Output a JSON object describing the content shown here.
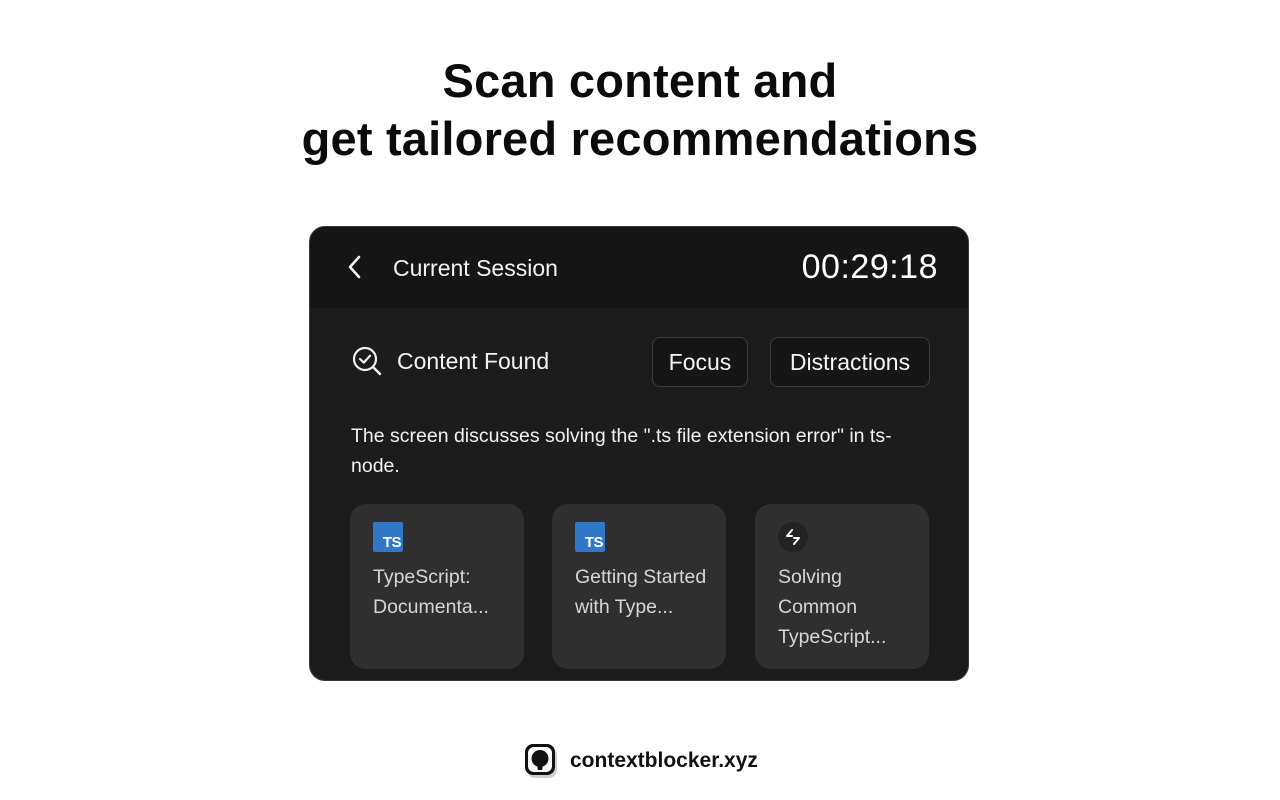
{
  "headline": {
    "line1": "Scan content and",
    "line2": "get tailored recommendations"
  },
  "session": {
    "title": "Current Session",
    "timer": "00:29:18",
    "back_icon": "chevron-left-icon"
  },
  "content": {
    "label": "Content Found",
    "icon": "scan-check-icon",
    "filters": {
      "focus": "Focus",
      "distractions": "Distractions"
    },
    "description": "The screen discusses solving the \".ts file extension error\" in ts-node."
  },
  "recommendations": [
    {
      "title": "TypeScript: Documenta...",
      "icon": "typescript-icon",
      "badge": "TS"
    },
    {
      "title": "Getting Started with Type...",
      "icon": "typescript-icon",
      "badge": "TS"
    },
    {
      "title": "Solving Common TypeScript...",
      "icon": "tool-icon",
      "badge": ""
    }
  ],
  "footer": {
    "brand": "contextblocker.xyz",
    "logo": "contextblocker-logo"
  },
  "colors": {
    "window_bg": "#1c1c1c",
    "titlebar_bg": "#151515",
    "card_bg": "#2f2f2f",
    "ts_blue": "#3178c6"
  }
}
